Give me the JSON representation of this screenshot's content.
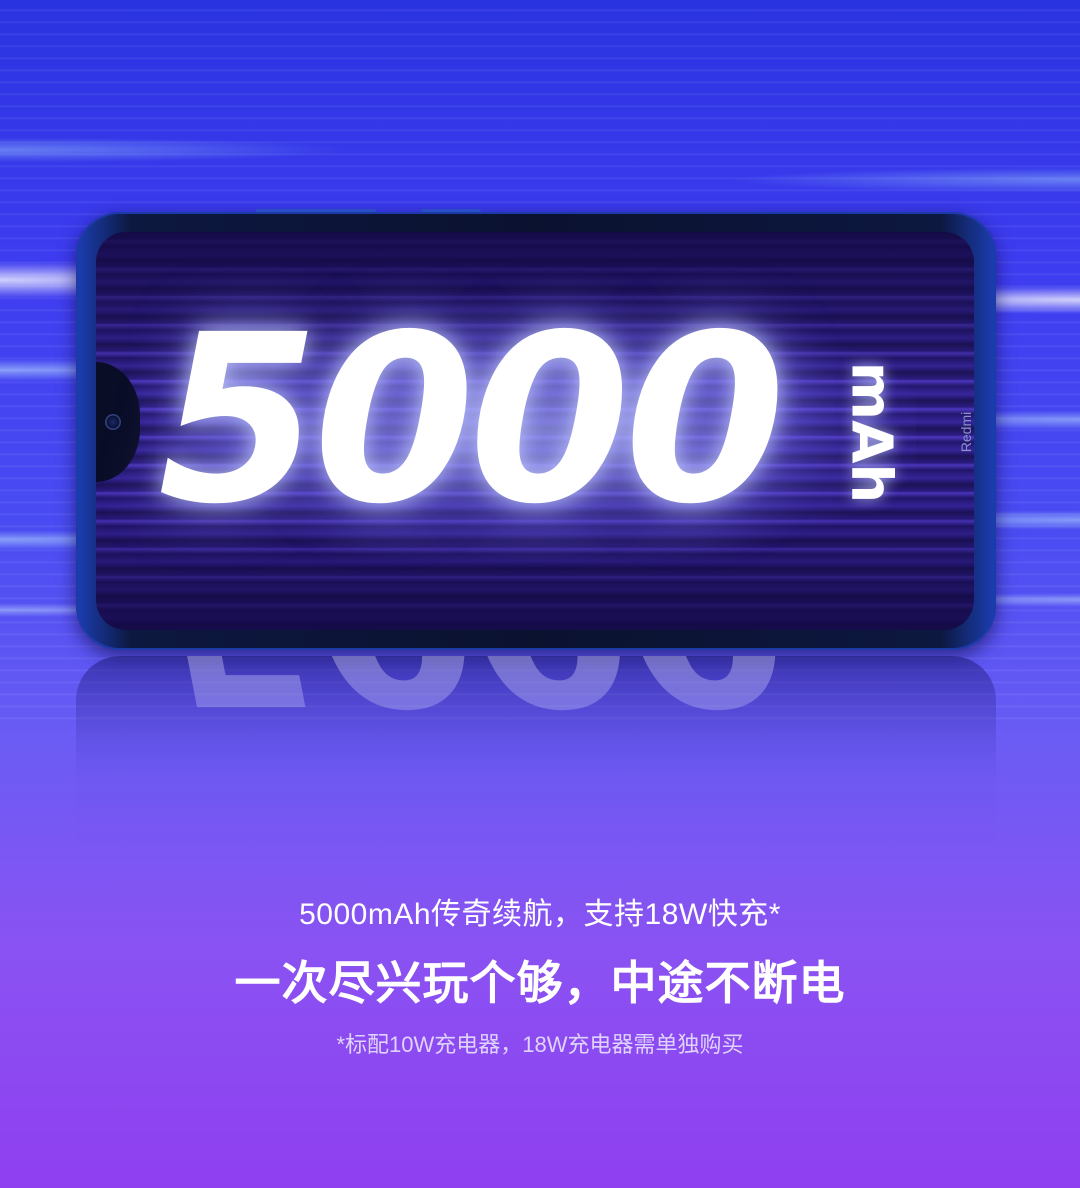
{
  "hero": {
    "capacity_number": "5000",
    "capacity_unit": "mAh",
    "phone_brand": "Redmi"
  },
  "copy": {
    "line1": "5000mAh传奇续航，支持18W快充*",
    "line2": "一次尽兴玩个够，中途不断电",
    "footnote": "*标配10W充电器，18W充电器需单独购买"
  },
  "colors": {
    "background_top": "#2a33e0",
    "background_bottom": "#8f3ff0",
    "text": "#ffffff"
  }
}
